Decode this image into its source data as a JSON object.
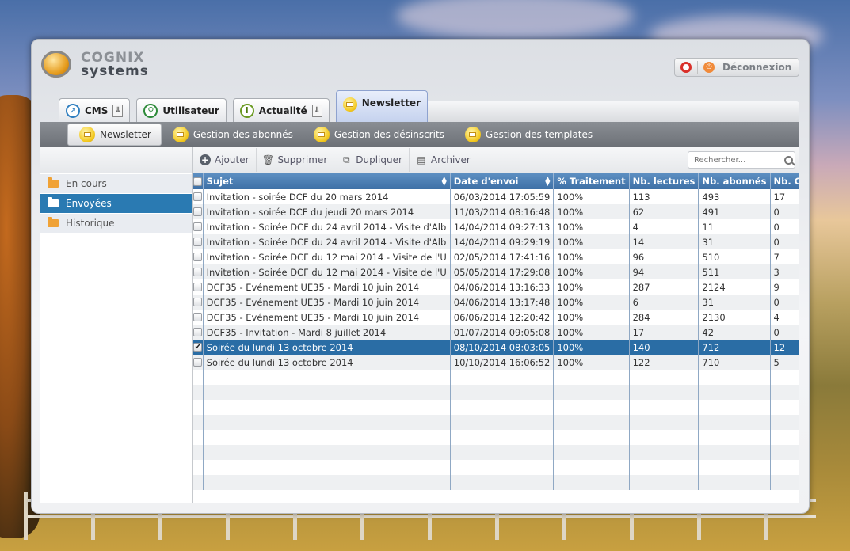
{
  "brand": {
    "line1": "COGNIX",
    "line2": "systems"
  },
  "logout": {
    "label": "Déconnexion"
  },
  "tabs": [
    {
      "label": "CMS",
      "icon": "compass-icon",
      "download": true,
      "active": false
    },
    {
      "label": "Utilisateur",
      "icon": "runner-icon",
      "download": false,
      "active": false
    },
    {
      "label": "Actualité",
      "icon": "info-icon",
      "download": true,
      "active": false
    },
    {
      "label": "Newsletter",
      "icon": "envelope-icon",
      "download": false,
      "active": true
    }
  ],
  "subnav": [
    {
      "label": "Newsletter",
      "active": true
    },
    {
      "label": "Gestion des abonnés",
      "active": false
    },
    {
      "label": "Gestion des désinscrits",
      "active": false
    },
    {
      "label": "Gestion des templates",
      "active": false
    }
  ],
  "sidebar": {
    "items": [
      {
        "label": "En cours",
        "active": false
      },
      {
        "label": "Envoyées",
        "active": true
      },
      {
        "label": "Historique",
        "active": false
      }
    ]
  },
  "toolbar": {
    "add": "Ajouter",
    "delete": "Supprimer",
    "duplicate": "Dupliquer",
    "archive": "Archiver",
    "search_placeholder": "Rechercher..."
  },
  "grid": {
    "columns": [
      "Sujet",
      "Date d'envoi",
      "% Traitement",
      "Nb. lectures",
      "Nb. abonnés",
      "Nb. Clic"
    ],
    "rows": [
      {
        "checked": false,
        "selected": false,
        "cells": [
          "Invitation - soirée DCF du 20 mars 2014",
          "06/03/2014 17:05:59",
          "100%",
          "113",
          "493",
          "17"
        ]
      },
      {
        "checked": false,
        "selected": false,
        "cells": [
          "Invitation - soirée DCF du jeudi 20 mars 2014",
          "11/03/2014 08:16:48",
          "100%",
          "62",
          "491",
          "0"
        ]
      },
      {
        "checked": false,
        "selected": false,
        "cells": [
          "Invitation - Soirée DCF du 24 avril 2014 - Visite d'Alb",
          "14/04/2014 09:27:13",
          "100%",
          "4",
          "11",
          "0"
        ]
      },
      {
        "checked": false,
        "selected": false,
        "cells": [
          "Invitation - Soirée DCF du 24 avril 2014 - Visite d'Alb",
          "14/04/2014 09:29:19",
          "100%",
          "14",
          "31",
          "0"
        ]
      },
      {
        "checked": false,
        "selected": false,
        "cells": [
          "Invitation - Soirée DCF du 12 mai 2014 - Visite de l'U",
          "02/05/2014 17:41:16",
          "100%",
          "96",
          "510",
          "7"
        ]
      },
      {
        "checked": false,
        "selected": false,
        "cells": [
          "Invitation - Soirée DCF du 12 mai 2014 - Visite de l'U",
          "05/05/2014 17:29:08",
          "100%",
          "94",
          "511",
          "3"
        ]
      },
      {
        "checked": false,
        "selected": false,
        "cells": [
          "DCF35 - Evénement UE35 - Mardi 10 juin 2014",
          "04/06/2014 13:16:33",
          "100%",
          "287",
          "2124",
          "9"
        ]
      },
      {
        "checked": false,
        "selected": false,
        "cells": [
          "DCF35 - Evénement UE35 - Mardi 10 juin 2014",
          "04/06/2014 13:17:48",
          "100%",
          "6",
          "31",
          "0"
        ]
      },
      {
        "checked": false,
        "selected": false,
        "cells": [
          "DCF35 - Evénement UE35 - Mardi 10 juin 2014",
          "06/06/2014 12:20:42",
          "100%",
          "284",
          "2130",
          "4"
        ]
      },
      {
        "checked": false,
        "selected": false,
        "cells": [
          "DCF35 - Invitation - Mardi 8 juillet 2014",
          "01/07/2014 09:05:08",
          "100%",
          "17",
          "42",
          "0"
        ]
      },
      {
        "checked": true,
        "selected": true,
        "cells": [
          "Soirée du lundi 13 octobre 2014",
          "08/10/2014 08:03:05",
          "100%",
          "140",
          "712",
          "12"
        ]
      },
      {
        "checked": false,
        "selected": false,
        "cells": [
          "Soirée du lundi 13 octobre 2014",
          "10/10/2014 16:06:52",
          "100%",
          "122",
          "710",
          "5"
        ]
      }
    ]
  },
  "colors": {
    "accent": "#2a6da5",
    "header": "#4a7db3",
    "subnav": "#777b81"
  }
}
